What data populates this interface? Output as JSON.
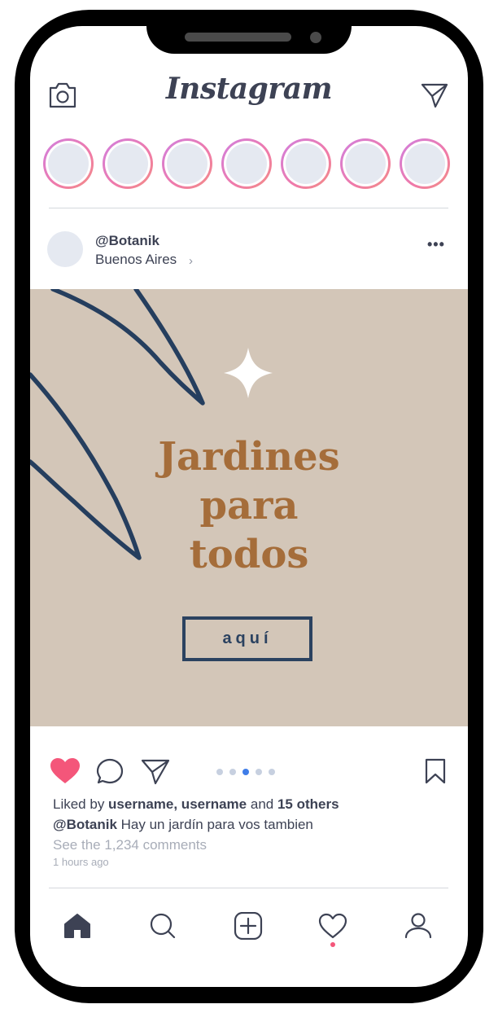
{
  "app": {
    "logo_text": "Instagram"
  },
  "colors": {
    "accent": "#f4567a",
    "ink": "#3d4254",
    "post_bg": "#d3c6b8",
    "headline": "#a56d3a",
    "navy": "#2b4260"
  },
  "header": {
    "left_icon": "camera-icon",
    "right_icon": "send-icon"
  },
  "stories": {
    "count": 7
  },
  "post": {
    "username": "@Botanik",
    "location": "Buenos Aires",
    "location_chevron": "›",
    "menu": "•••",
    "headline_lines": [
      "Jardines",
      "para",
      "todos"
    ],
    "cta_label": "aquí"
  },
  "actions": {
    "liked": true,
    "carousel_pages": 5,
    "carousel_active": 3
  },
  "meta": {
    "liked_prefix": "Liked by ",
    "liked_users": "username, username",
    "liked_and": " and ",
    "liked_others": "15 others",
    "caption_user": "@Botanik",
    "caption_text": " Hay un jardín para vos tambien",
    "comments_link": "See the 1,234 comments",
    "timestamp": "1 hours ago"
  },
  "bottom_nav": [
    "home-icon",
    "search-icon",
    "add-post-icon",
    "heart-icon",
    "profile-icon"
  ]
}
